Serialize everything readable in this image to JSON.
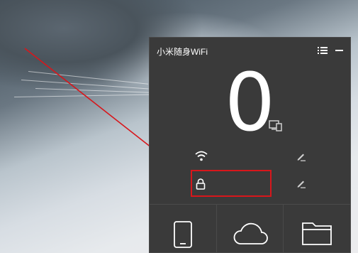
{
  "window": {
    "title": "小米随身WiFi",
    "menu_icon": "list-icon",
    "minimize_icon": "minimize-icon"
  },
  "status": {
    "connected_devices": "0",
    "devices_icon": "devices-icon"
  },
  "network": {
    "ssid": "",
    "password": "",
    "wifi_icon": "wifi-icon",
    "lock_icon": "lock-icon",
    "edit_icon": "pencil-icon"
  },
  "bottom_bar": {
    "items": [
      {
        "icon": "phone-icon"
      },
      {
        "icon": "cloud-icon"
      },
      {
        "icon": "folder-icon"
      }
    ]
  },
  "colors": {
    "panel_bg": "#3a3a3a",
    "highlight_red": "#d8161b",
    "annotation_arrow": "#d8161b"
  }
}
